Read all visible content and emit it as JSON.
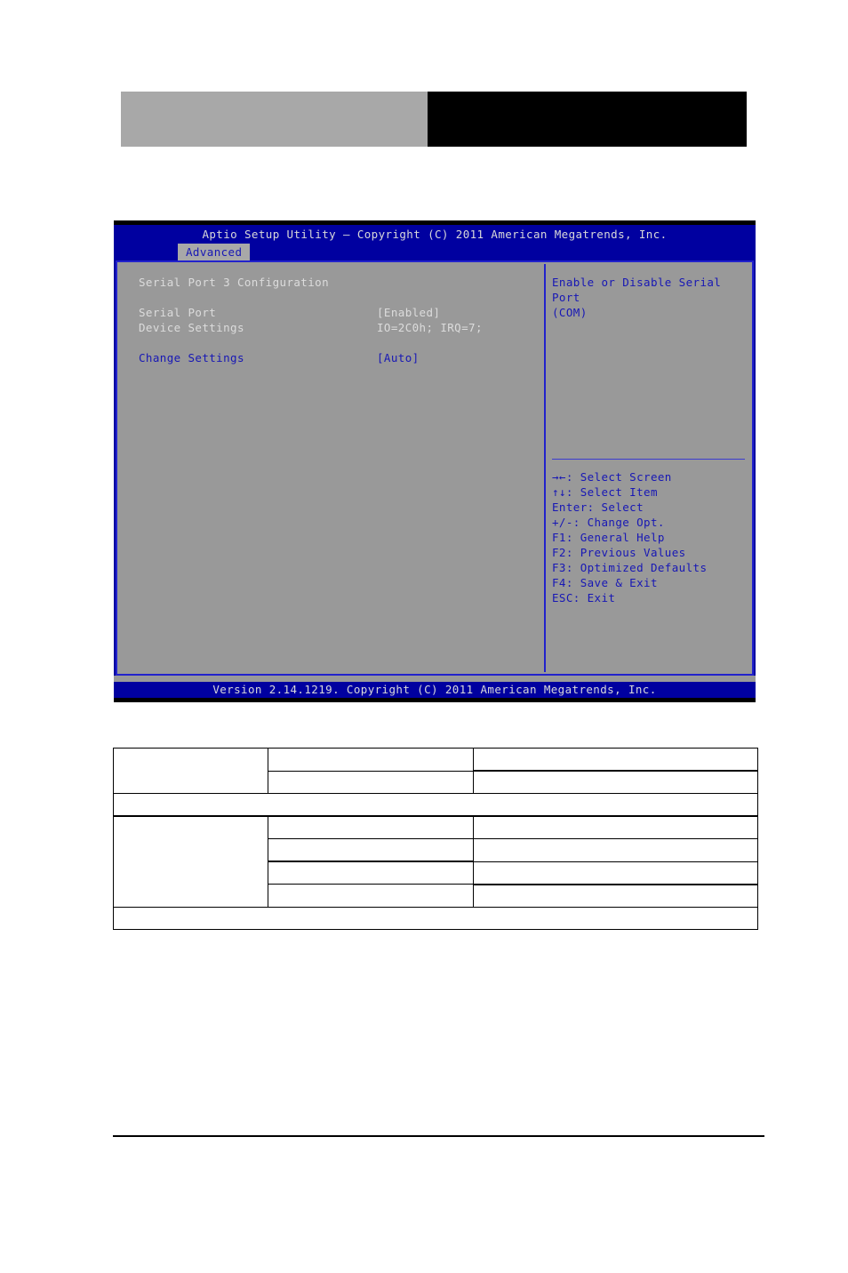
{
  "banner": {
    "left_block_label": "",
    "right_block_label": ""
  },
  "bios": {
    "title": "Aptio Setup Utility – Copyright (C) 2011 American Megatrends, Inc.",
    "active_tab": "Advanced",
    "section_title": "Serial Port 3 Configuration",
    "rows": [
      {
        "label": "Serial Port",
        "value": "[Enabled]",
        "label_color": "white",
        "value_color": "white"
      },
      {
        "label": "Device Settings",
        "value": "IO=2C0h; IRQ=7;",
        "label_color": "white",
        "value_color": "white"
      },
      {
        "label": "Change Settings",
        "value": "[Auto]",
        "label_color": "blue",
        "value_color": "blue"
      }
    ],
    "help_text": "Enable or Disable Serial Port\n(COM)",
    "legend": [
      "→←: Select Screen",
      "↑↓: Select Item",
      "Enter: Select",
      "+/-: Change Opt.",
      "F1: General Help",
      "F2: Previous Values",
      "F3: Optimized Defaults",
      "F4: Save & Exit",
      "ESC: Exit"
    ],
    "footer": "Version 2.14.1219. Copyright (C) 2011 American Megatrends, Inc.",
    "colors": {
      "titlebar_bg": "#0000a0",
      "body_bg": "#999999",
      "border": "#2222cc",
      "accent_text": "#1717b5",
      "plain_text": "#dcdcdc"
    }
  },
  "spec_table": {
    "rows": [
      {
        "cells": [
          "",
          "",
          ""
        ]
      },
      {
        "cells": [
          "",
          "",
          ""
        ]
      },
      {
        "cells": [
          ""
        ]
      },
      {
        "cells": [
          "",
          "",
          ""
        ]
      },
      {
        "cells": [
          "",
          "",
          ""
        ]
      },
      {
        "cells": [
          "",
          "",
          ""
        ]
      },
      {
        "cells": [
          "",
          "",
          ""
        ]
      },
      {
        "cells": [
          ""
        ]
      }
    ]
  }
}
